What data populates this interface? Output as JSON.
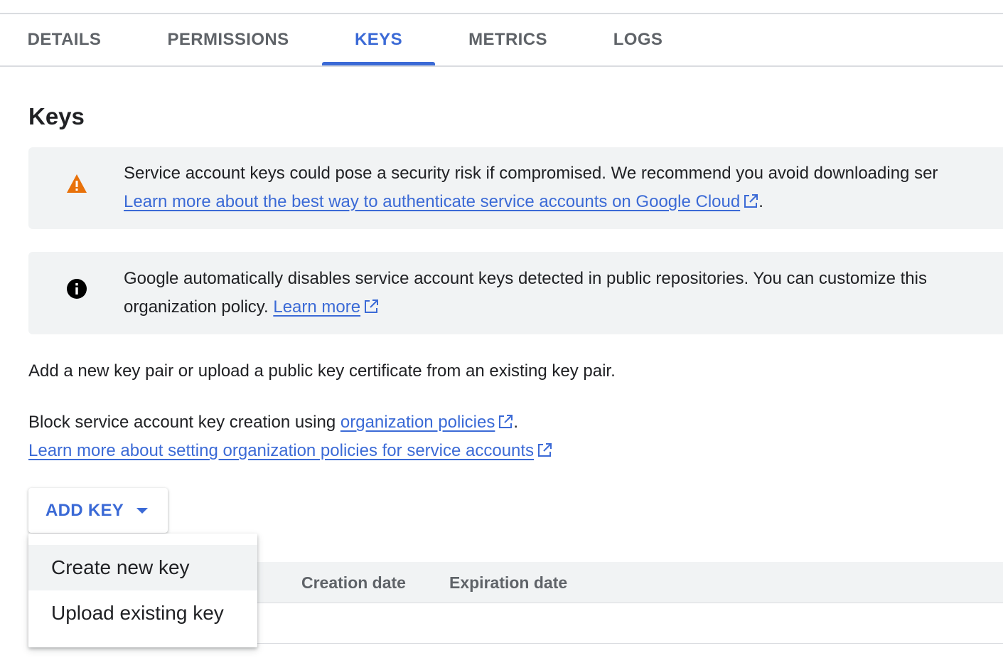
{
  "tabs": [
    {
      "label": "DETAILS",
      "active": false
    },
    {
      "label": "PERMISSIONS",
      "active": false
    },
    {
      "label": "KEYS",
      "active": true
    },
    {
      "label": "METRICS",
      "active": false
    },
    {
      "label": "LOGS",
      "active": false
    }
  ],
  "heading": "Keys",
  "warning_banner": {
    "icon": "warning-icon",
    "text": "Service account keys could pose a security risk if compromised. We recommend you avoid downloading ser",
    "link": "Learn more about the best way to authenticate service accounts on Google Cloud",
    "suffix": "."
  },
  "info_banner": {
    "icon": "info-icon",
    "text": "Google automatically disables service account keys detected in public repositories. You can customize this",
    "text2": "organization policy.",
    "link": "Learn more"
  },
  "intro_text": "Add a new key pair or upload a public key certificate from an existing key pair.",
  "block_text": "Block service account key creation using",
  "block_link": "organization policies",
  "block_suffix": ".",
  "learn_link": "Learn more about setting organization policies for service accounts",
  "add_key_label": "ADD KEY",
  "menu": {
    "items": [
      "Create new key",
      "Upload existing key"
    ]
  },
  "table": {
    "columns": [
      "Creation date",
      "Expiration date"
    ]
  },
  "colors": {
    "accent": "#3b6ad6",
    "warning": "#e8710a",
    "banner_bg": "#f1f3f4"
  }
}
